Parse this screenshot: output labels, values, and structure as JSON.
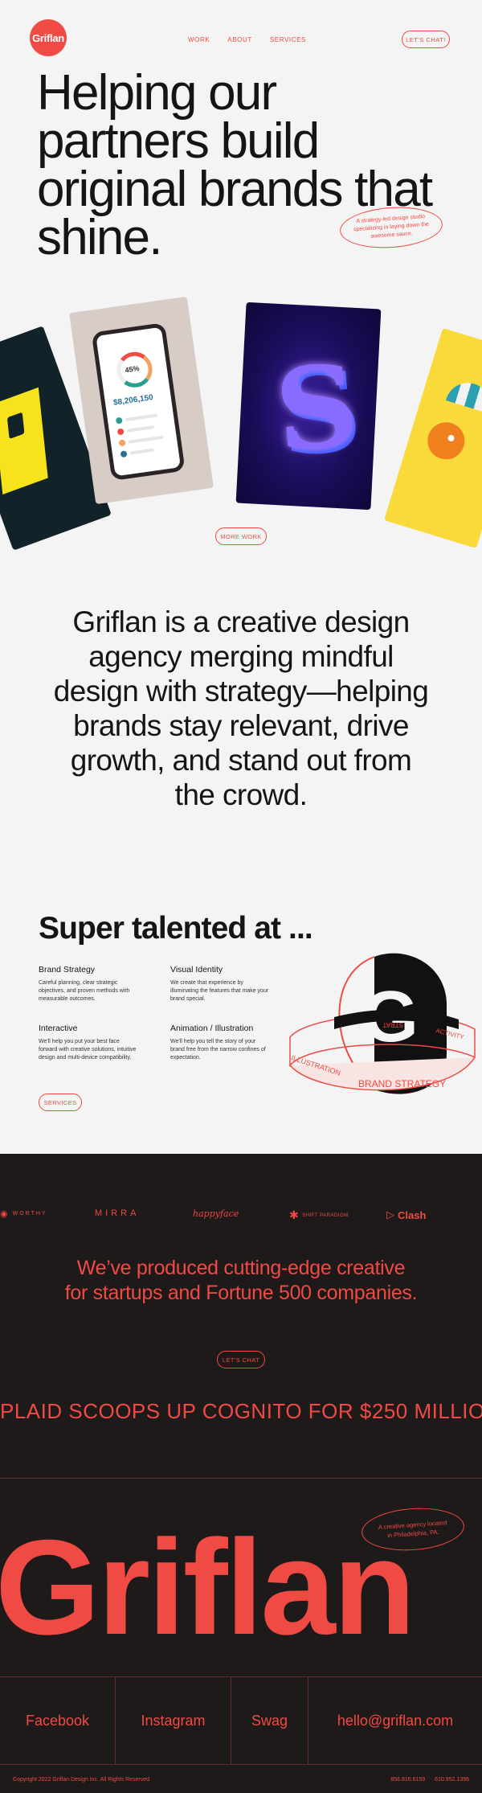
{
  "header": {
    "logo": "Griflan",
    "nav": [
      "WORK",
      "ABOUT",
      "SERVICES"
    ],
    "cta": "LET'S CHAT!"
  },
  "hero": {
    "title": "Helping our partners build original brands that shine.",
    "tag": "A strategy-led design studio specializing in laying down the awesome sauce."
  },
  "carousel": {
    "app_percent": "45%",
    "app_amount": "$8,206,150",
    "more_button": "MORE WORK"
  },
  "about": {
    "text": "Griflan is a creative design agency merging mindful design with strategy—helping brands stay relevant, drive growth, and stand out from the crowd."
  },
  "skills": {
    "title": "Super talented at ...",
    "items": [
      {
        "title": "Brand Strategy",
        "text": "Careful planning, clear strategic objectives, and proven methods with measurable outcomes."
      },
      {
        "title": "Visual Identity",
        "text": "We create that experience by illuminating the features that make your brand special."
      },
      {
        "title": "Interactive",
        "text": "We'll help you put your best face forward with creative solutions, intuitive design and multi-device compatibility."
      },
      {
        "title": "Animation / Illustration",
        "text": "We'll help you tell the story of your brand free from the narrow confines of expectation."
      }
    ],
    "services_button": "SERVICES",
    "ring_labels": [
      "BRAND STRATEGY",
      "ILLUSTRATION",
      "ACTIVITY",
      "STRAT"
    ]
  },
  "clients": {
    "logos": [
      "WORTHY",
      "MIRRA",
      "happyface",
      "SHIFT PARADIGM",
      "Clash"
    ],
    "headline": "We’ve produced cutting-edge creative for startups and Fortune 500 companies.",
    "cta": "LET'S CHAT",
    "ticker": "PLAID SCOOPS UP COGNITO FOR $250 MILLIO"
  },
  "footer": {
    "tag": "A creative agency located in Philadelphia, PA.",
    "big_word": "Griflan",
    "links": [
      "Facebook",
      "Instagram",
      "Swag",
      "hello@griflan.com"
    ],
    "copyright": "Copyright 2022 Griflan Design Inc. All Rights Reserved",
    "phones": [
      "856.816.6159",
      "610.952.1396"
    ]
  },
  "colors": {
    "accent": "#ef4a43",
    "background": "#f4f4f4",
    "dark": "#1e1a1a"
  }
}
